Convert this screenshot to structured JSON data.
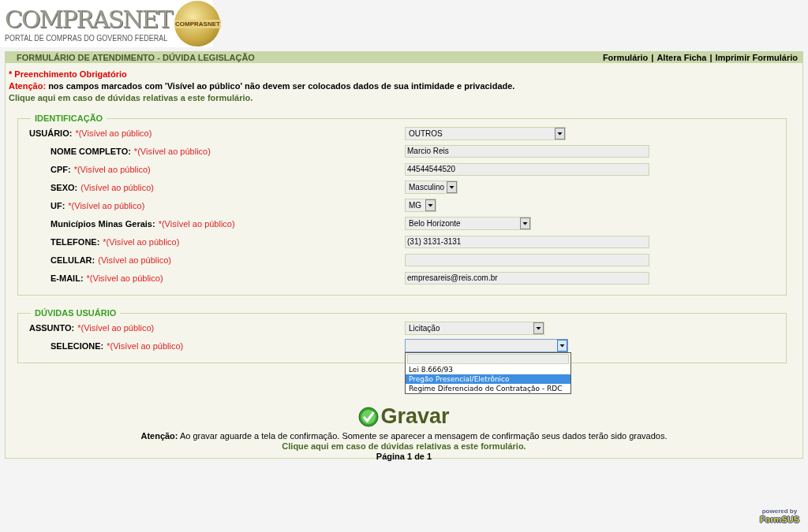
{
  "header": {
    "logo_title": "COMPRASNET",
    "logo_subtitle": "PORTAL DE COMPRAS DO GOVERNO FEDERAL",
    "seal_text": "COMPRASNET"
  },
  "form": {
    "title": "FORMULÁRIO DE ATENDIMENTO - DÚVIDA LEGISLAÇÃO",
    "links": [
      "Formulário",
      "Altera Ficha",
      "Imprimir Formulário"
    ],
    "separator": "|",
    "required_note": "* Preenchimento Obrigatório",
    "warning": {
      "label": "Atenção:",
      "text": "nos campos marcados com 'Visível ao público' não devem ser colocados dados de sua intimidade e privacidade."
    },
    "help_link": "Clique aqui em caso de dúvidas relativas a este formulário.",
    "sections": [
      {
        "legend": "IDENTIFICAÇÃO",
        "fields": [
          {
            "label": "USUÁRIO:",
            "note": "*(Visível ao público)",
            "kind": "select",
            "value": "OUTROS",
            "children": [
              {
                "label": "NOME COMPLETO:",
                "note": "*(Visível ao público)",
                "kind": "text",
                "value": "Marcio Reis"
              },
              {
                "label": "CPF:",
                "note": "*(Visível ao público)",
                "kind": "text",
                "value": "44544544520"
              },
              {
                "label": "SEXO:",
                "note": "(Visível ao público)",
                "kind": "select",
                "value": "Masculino"
              },
              {
                "label": "UF:",
                "note": "*(Visível ao público)",
                "kind": "select",
                "value": "MG"
              },
              {
                "label": "Municípios Minas Gerais:",
                "note": "*(Visível ao público)",
                "kind": "select",
                "value": "Belo Horizonte"
              },
              {
                "label": "TELEFONE:",
                "note": "*(Visível ao público)",
                "kind": "text",
                "value": "(31) 3131-3131"
              },
              {
                "label": "CELULAR:",
                "note": "(Visível ao público)",
                "kind": "text"
              },
              {
                "label": "E-MAIL:",
                "note": "*(Visível ao público)",
                "kind": "text",
                "value": "empresareis@reis.com.br"
              }
            ]
          }
        ]
      },
      {
        "legend": "DÚVIDAS USUÁRIO",
        "fields": [
          {
            "label": "ASSUNTO:",
            "note": "*(Visível ao público)",
            "kind": "select",
            "value": "Licitação",
            "children": [
              {
                "label": "SELECIONE:",
                "note": "*(Visível ao público)",
                "kind": "select",
                "open": true,
                "options": [
                  {
                    "label": "Lei 8.666/93",
                    "selected": false
                  },
                  {
                    "label": "Pregão Presencial/Eletrônico",
                    "selected": true
                  },
                  {
                    "label": "Regime Diferenciado de Contratação - RDC",
                    "selected": false
                  }
                ]
              }
            ]
          }
        ]
      }
    ],
    "save_button": "Gravar",
    "footer_warning": {
      "label": "Atenção:",
      "text": "Ao gravar aguarde a tela de confirmação. Somente se aparecer a mensagem de confirmação seus dados terão sido gravados."
    },
    "footer_help_link": "Clique aqui em caso de dúvidas relativas a este formulário.",
    "page_info": "Página 1 de 1"
  },
  "powered": {
    "label": "powered by",
    "brand": "FormSUS"
  }
}
